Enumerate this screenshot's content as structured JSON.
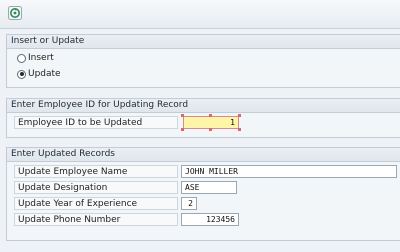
{
  "toolbar": {
    "execute_icon": "execute-icon"
  },
  "insert_update": {
    "header": "Insert or Update",
    "options": [
      {
        "label": "Insert",
        "selected": false
      },
      {
        "label": "Update",
        "selected": true
      }
    ]
  },
  "employee_id_section": {
    "header": "Enter Employee ID for Updating Record",
    "label": "Employee ID to be Updated",
    "value": "1"
  },
  "records_section": {
    "header": "Enter Updated Records",
    "fields": [
      {
        "label": "Update Employee Name",
        "value": "JOHN MILLER"
      },
      {
        "label": "Update Designation",
        "value": "ASE"
      },
      {
        "label": "Update Year of Experience",
        "value": "2"
      },
      {
        "label": "Update Phone Number",
        "value": "123456"
      }
    ]
  }
}
